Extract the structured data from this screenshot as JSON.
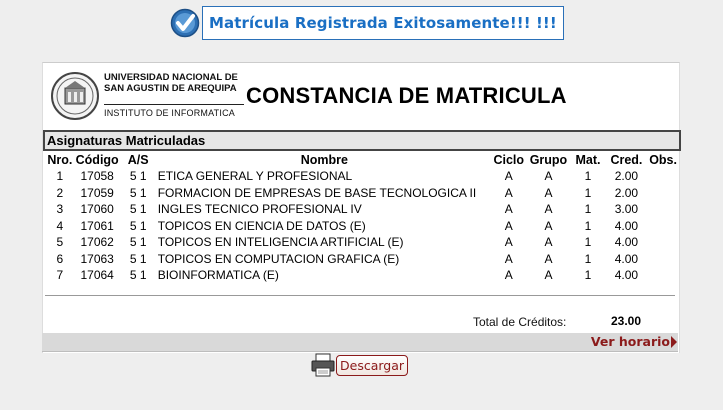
{
  "banner": {
    "message": "Matrícula Registrada Exitosamente!!! !!!"
  },
  "header": {
    "institution_line1": "UNIVERSIDAD NACIONAL DE",
    "institution_line2": "SAN AGUSTIN DE AREQUIPA",
    "institute": "INSTITUTO DE INFORMATICA",
    "title": "CONSTANCIA DE MATRICULA"
  },
  "section": {
    "title": "Asignaturas Matriculadas"
  },
  "table": {
    "columns": [
      "Nro.",
      "Código",
      "A/S",
      "Nombre",
      "Ciclo",
      "Grupo",
      "Mat.",
      "Cred.",
      "Obs."
    ],
    "rows": [
      {
        "nro": "1",
        "codigo": "17058",
        "as": "5 1",
        "nombre": "ETICA GENERAL Y PROFESIONAL",
        "ciclo": "A",
        "grupo": "A",
        "mat": "1",
        "cred": "2.00",
        "obs": ""
      },
      {
        "nro": "2",
        "codigo": "17059",
        "as": "5 1",
        "nombre": "FORMACION DE EMPRESAS DE BASE TECNOLOGICA II",
        "ciclo": "A",
        "grupo": "A",
        "mat": "1",
        "cred": "2.00",
        "obs": ""
      },
      {
        "nro": "3",
        "codigo": "17060",
        "as": "5 1",
        "nombre": "INGLES TECNICO PROFESIONAL IV",
        "ciclo": "A",
        "grupo": "A",
        "mat": "1",
        "cred": "3.00",
        "obs": ""
      },
      {
        "nro": "4",
        "codigo": "17061",
        "as": "5 1",
        "nombre": "TOPICOS EN CIENCIA DE DATOS (E)",
        "ciclo": "A",
        "grupo": "A",
        "mat": "1",
        "cred": "4.00",
        "obs": ""
      },
      {
        "nro": "5",
        "codigo": "17062",
        "as": "5 1",
        "nombre": "TOPICOS EN INTELIGENCIA ARTIFICIAL (E)",
        "ciclo": "A",
        "grupo": "A",
        "mat": "1",
        "cred": "4.00",
        "obs": ""
      },
      {
        "nro": "6",
        "codigo": "17063",
        "as": "5 1",
        "nombre": "TOPICOS EN COMPUTACION GRAFICA (E)",
        "ciclo": "A",
        "grupo": "A",
        "mat": "1",
        "cred": "4.00",
        "obs": ""
      },
      {
        "nro": "7",
        "codigo": "17064",
        "as": "5 1",
        "nombre": "BIOINFORMATICA (E)",
        "ciclo": "A",
        "grupo": "A",
        "mat": "1",
        "cred": "4.00",
        "obs": ""
      }
    ]
  },
  "totals": {
    "label": "Total de Créditos:",
    "value": "23.00"
  },
  "links": {
    "horario": "Ver horario"
  },
  "actions": {
    "download_label": "Descargar"
  },
  "colors": {
    "banner_text": "#1a6fc4",
    "link": "#8b1a1a",
    "page_bg": "#eeeeee"
  },
  "icons": {
    "banner": "checkmark-icon",
    "download": "printer-icon",
    "link_arrow": "arrow-right-icon",
    "seal": "university-seal-icon"
  }
}
